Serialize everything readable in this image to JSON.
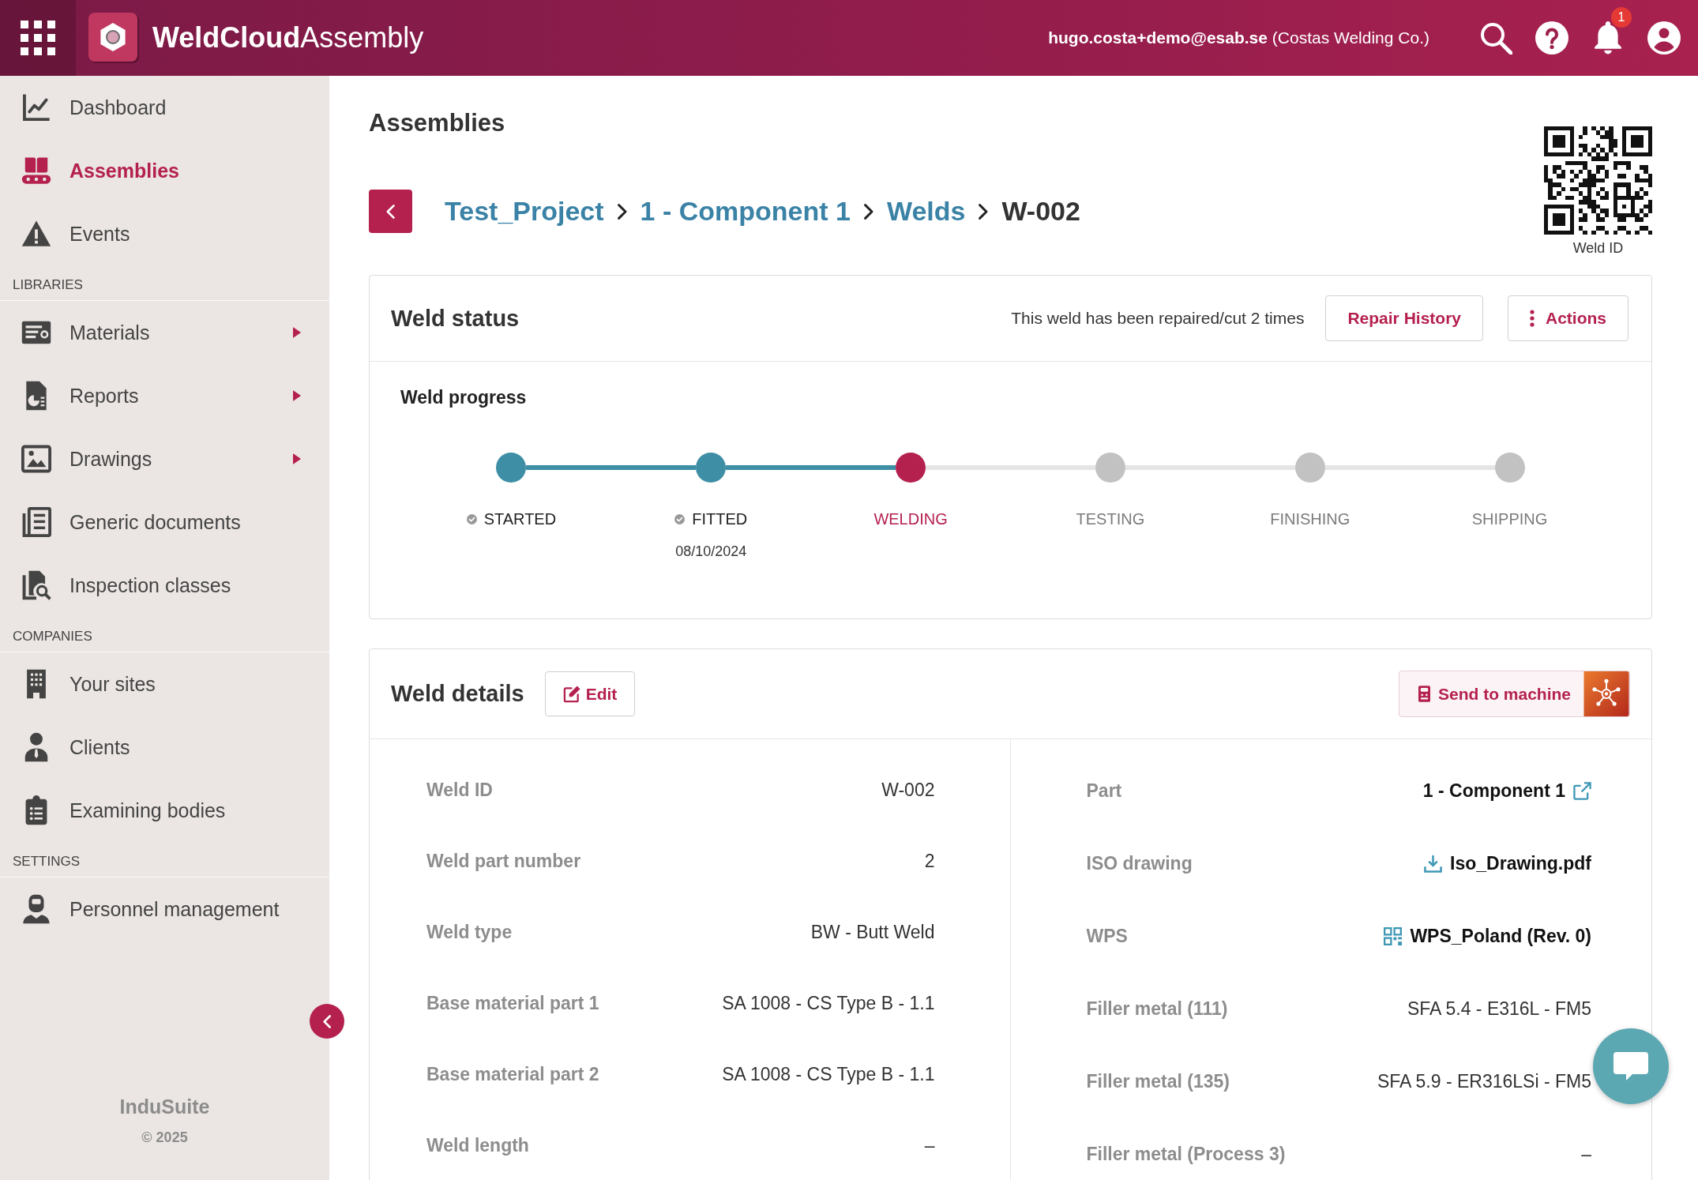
{
  "top_bar": {
    "app_title": "**WeldCloud**Assembly",
    "user_label": "**hugo.costa+demo@esab.se** (Costas Welding Co.)",
    "notification_count": "1"
  },
  "sidebar": {
    "groups": [
      {
        "items": [
          {
            "label": "Dashboard",
            "selected": false,
            "submenu": false
          },
          {
            "label": "Assemblies",
            "selected": true,
            "submenu": false
          },
          {
            "label": "Events",
            "selected": false,
            "submenu": false
          }
        ]
      },
      {
        "heading": "LIBRARIES",
        "items": [
          {
            "label": "Materials",
            "selected": false,
            "submenu": true
          },
          {
            "label": "Reports",
            "selected": false,
            "submenu": true
          },
          {
            "label": "Drawings",
            "selected": false,
            "submenu": true
          },
          {
            "label": "Generic documents",
            "selected": false,
            "submenu": false
          },
          {
            "label": "Inspection classes",
            "selected": false,
            "submenu": false
          }
        ]
      },
      {
        "heading": "COMPANIES",
        "items": [
          {
            "label": "Your sites",
            "selected": false,
            "submenu": false
          },
          {
            "label": "Clients",
            "selected": false,
            "submenu": false
          },
          {
            "label": "Examining bodies",
            "selected": false,
            "submenu": false
          }
        ]
      },
      {
        "heading": "SETTINGS",
        "items": [
          {
            "label": "Personnel management",
            "selected": false,
            "submenu": false
          }
        ]
      }
    ],
    "footer_brand": "InduSuite",
    "footer_copyright": "© 2025"
  },
  "page_title": "Assemblies",
  "breadcrumb": [
    {
      "label": "Test_Project",
      "current": false
    },
    {
      "label": "1 - Component 1",
      "current": false
    },
    {
      "label": "Welds",
      "current": false
    },
    {
      "label": "W-002",
      "current": true
    }
  ],
  "qr_caption": "Weld ID",
  "weld_status": {
    "title": "Weld status",
    "repair_note": "This weld has been repaired/cut 2 times",
    "buttons": [
      {
        "label": "Repair History",
        "kind": "plain"
      },
      {
        "label": "Actions",
        "kind": "menu"
      }
    ],
    "progress_title": "Weld progress",
    "steps": [
      {
        "label": "STARTED",
        "completed": true,
        "current": false
      },
      {
        "label": "FITTED",
        "completed": true,
        "current": false,
        "date": "08/10/2024"
      },
      {
        "label": "WELDING",
        "completed": false,
        "current": true
      },
      {
        "label": "TESTING",
        "completed": false,
        "current": false
      },
      {
        "label": "FINISHING",
        "completed": false,
        "current": false
      },
      {
        "label": "SHIPPING",
        "completed": false,
        "current": false
      }
    ]
  },
  "weld_details": {
    "title": "Weld details",
    "edit_label": "Edit",
    "send_label": "Send to machine",
    "left": [
      {
        "label": "Weld ID",
        "value": "W-002",
        "kind": "text"
      },
      {
        "label": "Weld part number",
        "value": "2",
        "kind": "text"
      },
      {
        "label": "Weld type",
        "value": "BW - Butt Weld",
        "kind": "text"
      },
      {
        "label": "Base material part 1",
        "value": "SA 1008 - CS Type B - 1.1",
        "kind": "text"
      },
      {
        "label": "Base material part 2",
        "value": "SA 1008 - CS Type B - 1.1",
        "kind": "text"
      },
      {
        "label": "Weld length",
        "value": "–",
        "kind": "text"
      }
    ],
    "right": [
      {
        "label": "Part",
        "value": "1 - Component 1",
        "kind": "link"
      },
      {
        "label": "ISO drawing",
        "value": "Iso_Drawing.pdf",
        "kind": "download"
      },
      {
        "label": "WPS",
        "value": "WPS_Poland (Rev. 0)",
        "kind": "document"
      },
      {
        "label": "Filler metal (111)",
        "value": "SFA 5.4 - E316L - FM5",
        "kind": "text"
      },
      {
        "label": "Filler metal (135)",
        "value": "SFA 5.9 - ER316LSi - FM5",
        "kind": "text"
      },
      {
        "label": "Filler metal (Process 3)",
        "value": "–",
        "kind": "text"
      }
    ]
  }
}
